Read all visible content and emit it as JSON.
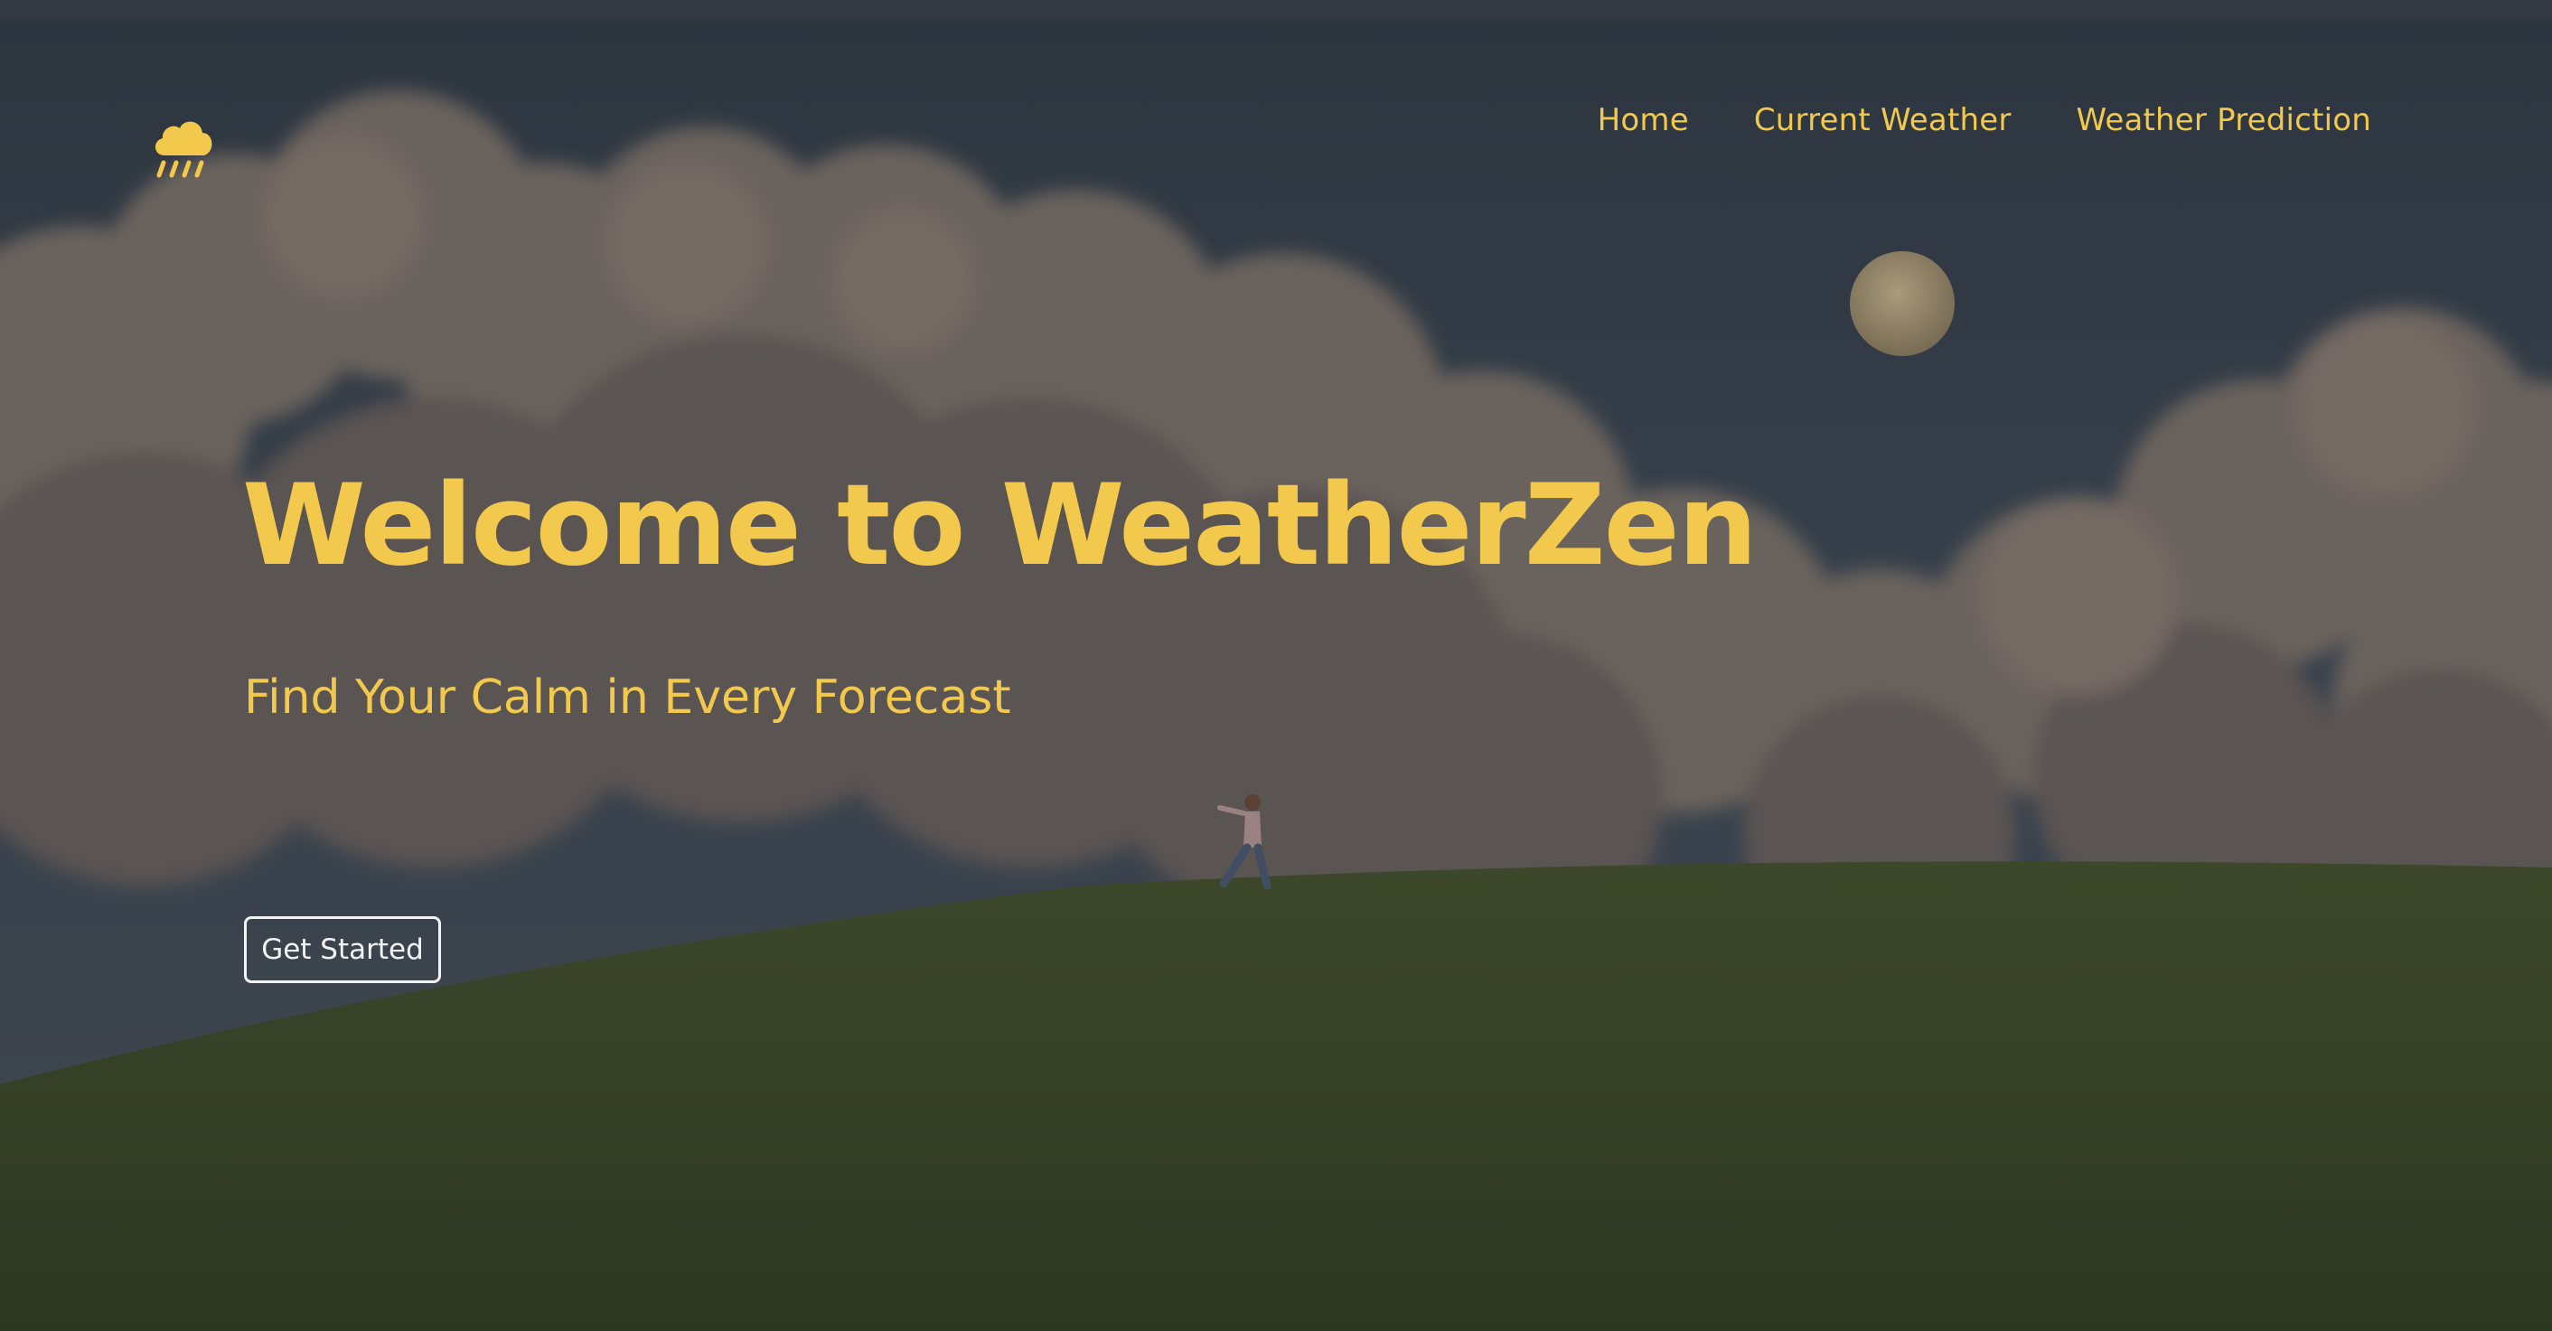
{
  "brand": {
    "logo_icon": "cloud-rain-icon",
    "accent_color": "#f2c94c"
  },
  "nav": {
    "items": [
      {
        "label": "Home"
      },
      {
        "label": "Current Weather"
      },
      {
        "label": "Weather Prediction"
      }
    ]
  },
  "hero": {
    "title": "Welcome to WeatherZen",
    "subtitle": "Find Your Calm in Every Forecast",
    "cta_label": "Get Started"
  }
}
